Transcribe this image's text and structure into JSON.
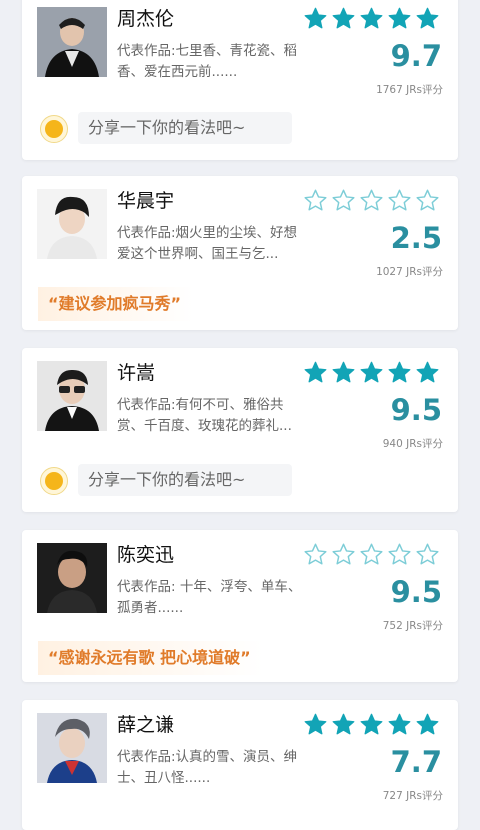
{
  "colors": {
    "star_filled": "#12a4b6",
    "star_outline": "#12a4b6",
    "score": "#2a8fa0",
    "quote_text": "#e07b2a"
  },
  "cards": [
    {
      "name": "周杰伦",
      "works": "代表作品:七里香、青花瓷、稻香、爱在西元前......",
      "stars_filled": 5,
      "score": "9.7",
      "count": "1767 JRs评分",
      "share_placeholder": "分享一下你的看法吧~"
    },
    {
      "name": "华晨宇",
      "works": "代表作品:烟火里的尘埃、好想爱这个世界啊、国王与乞...",
      "stars_filled": 0,
      "score": "2.5",
      "count": "1027 JRs评分",
      "quote": "“建议参加疯马秀”"
    },
    {
      "name": "许嵩",
      "works": "代表作品:有何不可、雅俗共赏、千百度、玫瑰花的葬礼...",
      "stars_filled": 5,
      "score": "9.5",
      "count": "940 JRs评分",
      "share_placeholder": "分享一下你的看法吧~"
    },
    {
      "name": "陈奕迅",
      "works": "代表作品: 十年、浮夸、单车、孤勇者......",
      "stars_filled": 0,
      "score": "9.5",
      "count": "752 JRs评分",
      "quote": "“感谢永远有歌 把心境道破”"
    },
    {
      "name": "薛之谦",
      "works": "代表作品:认真的雪、演员、绅士、丑八怪......",
      "stars_filled": 5,
      "score": "7.7",
      "count": "727 JRs评分"
    }
  ]
}
